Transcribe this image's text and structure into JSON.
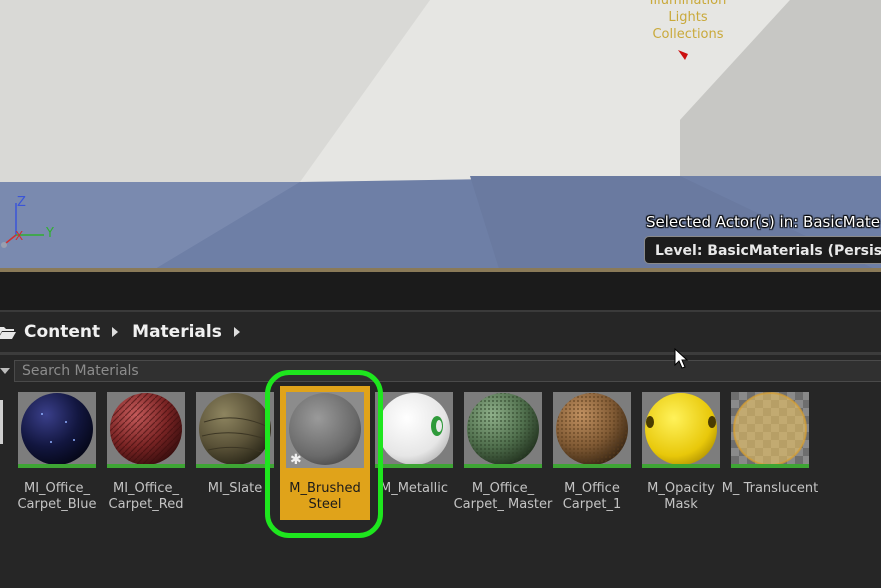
{
  "viewport": {
    "overlay_lines": [
      "Illumination",
      "Lights",
      "Collections"
    ],
    "axis": {
      "z": "Z",
      "x": "X",
      "y": "Y"
    },
    "selected_actor_text": "Selected Actor(s) in:  BasicMate",
    "level_text": "Level:  BasicMaterials (Persistent"
  },
  "breadcrumb": {
    "items": [
      "Content",
      "Materials"
    ]
  },
  "search": {
    "placeholder": "Search Materials"
  },
  "assets": [
    {
      "label": "MI_Office_ Carpet_Blue",
      "sphere": "dark-blue-carpet"
    },
    {
      "label": "MI_Office_ Carpet_Red",
      "sphere": "red-carpet"
    },
    {
      "label": "MI_Slate",
      "sphere": "slate"
    },
    {
      "label": "M_Brushed Steel",
      "sphere": "brushed-steel",
      "selected": true
    },
    {
      "label": "M_Metallic",
      "sphere": "metallic"
    },
    {
      "label": "M_Office_ Carpet_ Master",
      "sphere": "green-carpet"
    },
    {
      "label": "M_Office Carpet_1",
      "sphere": "brown-carpet"
    },
    {
      "label": "M_Opacity Mask",
      "sphere": "yellow"
    },
    {
      "label": "M_ Translucent",
      "sphere": "translucent"
    }
  ],
  "colors": {
    "selection": "#e0a31a",
    "highlight_ring": "#1ee61e",
    "asset_underline": "#3ea534"
  }
}
